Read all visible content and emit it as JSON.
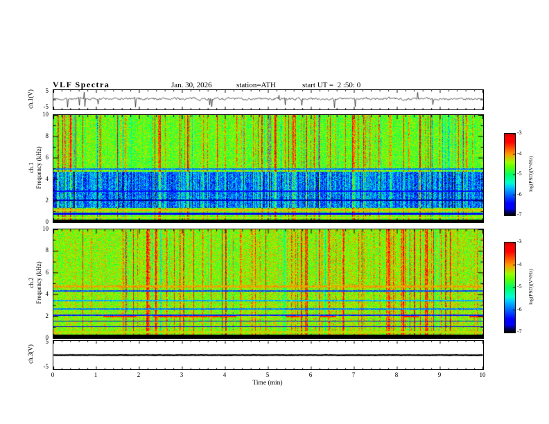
{
  "header": {
    "title": "VLF Spectra",
    "date": "Jan. 30, 2026",
    "station": "station=ATH",
    "start_ut": "start UT =  2 :50: 0"
  },
  "axes": {
    "time_label": "Time (min)",
    "time_ticks": [
      0,
      1,
      2,
      3,
      4,
      5,
      6,
      7,
      8,
      9,
      10
    ],
    "time_range_min": [
      0,
      10
    ],
    "freq_label": "Frequency (kHz)",
    "freq_ticks": [
      0,
      2,
      4,
      6,
      8,
      10
    ],
    "freq_range_khz": [
      0,
      10
    ],
    "volt_ticks": [
      5,
      -5
    ],
    "volt_range": [
      -5,
      5
    ]
  },
  "panels": {
    "ch1_wave": {
      "label": "ch.1(V)"
    },
    "ch1_spec": {
      "label": "ch.1"
    },
    "ch2_spec": {
      "label": "ch.2"
    },
    "ch3_wave": {
      "label": "ch.3(V)"
    }
  },
  "colorbar": {
    "label": "log(PSD)(V²/Hz)",
    "ticks": [
      -3,
      -4,
      -5,
      -6,
      -7
    ],
    "min": -7,
    "max": -3
  },
  "chart_data": [
    {
      "id": "ch1_wave",
      "type": "line",
      "ylabel": "ch.1(V)",
      "ylim": [
        -5,
        5
      ],
      "xlim_min": [
        0,
        10
      ],
      "summary": "Noisy broadband voltage trace near +0.5 V with frequent impulsive sferic spikes reaching about ±4 V",
      "render": {
        "seed": 7,
        "noise_amp": 0.55,
        "offset": 0.5,
        "spike_prob": 0.03,
        "spike_max": 4.3,
        "neg_bias": 0.62,
        "thickness": 0.7
      }
    },
    {
      "id": "ch1_spec",
      "type": "heatmap",
      "ylabel": "ch.1 Frequency (kHz)",
      "ylim": [
        0,
        10
      ],
      "xlim_min": [
        0,
        10
      ],
      "zlabel": "log(PSD)(V²/Hz)",
      "zlim": [
        -7,
        -3
      ],
      "summary": "VLF spectrogram: green broadband background (~-4.8), dense vertical sferic streaks up to yellow/red (~-3.5), suppressed blue band 1.4-4.7 kHz (~-6), thin horizontal emission/absorption lines near 0.45, 0.8, 1.1, 2.0, 2.9, 5.0 kHz, black band below 0.3 kHz",
      "render": {
        "seed": 42,
        "base_psd": -4.75,
        "base_noise": 0.42,
        "streak_prob": 0.3,
        "streak_max": 2.0,
        "dark_streak_prob": 0.1,
        "dark_streak_max": 1.5,
        "blue_band": {
          "f_low": 1.35,
          "f_high": 4.7,
          "depth": 1.35
        },
        "black_band_top_khz": 0.28,
        "lines": [
          {
            "f": 4.95,
            "w": 0.07,
            "v": -5.9
          },
          {
            "f": 2.9,
            "w": 0.05,
            "v": -6.4
          },
          {
            "f": 2.05,
            "w": 0.06,
            "v": -6.7
          },
          {
            "f": 1.1,
            "w": 0.1,
            "v": -4.15
          },
          {
            "f": 0.8,
            "w": 0.09,
            "v": -6.5
          },
          {
            "f": 0.45,
            "w": 0.09,
            "v": -4.3
          }
        ]
      }
    },
    {
      "id": "ch2_spec",
      "type": "heatmap",
      "ylabel": "ch.2 Frequency (kHz)",
      "ylim": [
        0,
        10
      ],
      "xlim_min": [
        0,
        10
      ],
      "zlabel": "log(PSD)(V²/Hz)",
      "zlim": [
        -7,
        -3
      ],
      "summary": "VLF spectrogram: mostly uniform green background with vertical sferic streaks, horizontal banding below 5 kHz including bright line ~4.75 kHz, intermittent red/orange segments ~1.95 kHz, dark lines 1.0-2.1 kHz, black band below 0.3 kHz",
      "render": {
        "seed": 1337,
        "base_psd": -4.6,
        "base_noise": 0.45,
        "streak_prob": 0.32,
        "streak_max": 1.7,
        "dark_streak_prob": 0.07,
        "dark_streak_max": 1.3,
        "black_band_top_khz": 0.3,
        "lines": [
          {
            "f": 4.75,
            "w": 0.1,
            "v": -4.05
          },
          {
            "f": 4.35,
            "w": 0.06,
            "v": -6.1
          },
          {
            "f": 3.45,
            "w": 0.07,
            "v": -5.7
          },
          {
            "f": 2.65,
            "w": 0.06,
            "v": -5.9
          },
          {
            "f": 2.1,
            "w": 0.08,
            "v": -6.3
          },
          {
            "f": 1.95,
            "w": 0.06,
            "v": -3.6,
            "prob": 0.4
          },
          {
            "f": 1.55,
            "w": 0.05,
            "v": -6.4
          },
          {
            "f": 1.05,
            "w": 0.06,
            "v": -6.5
          },
          {
            "f": 0.55,
            "w": 0.09,
            "v": -4.25
          }
        ]
      }
    },
    {
      "id": "ch3_wave",
      "type": "line",
      "ylabel": "ch.3(V)",
      "ylim": [
        -5,
        5
      ],
      "xlim_min": [
        0,
        10
      ],
      "summary": "Flat (inactive) channel: constant thick trace at ~0 V",
      "render": {
        "seed": 99,
        "noise_amp": 0.05,
        "offset": 0,
        "spike_prob": 0,
        "spike_max": 0,
        "neg_bias": 0,
        "thickness": 2.4
      }
    }
  ]
}
